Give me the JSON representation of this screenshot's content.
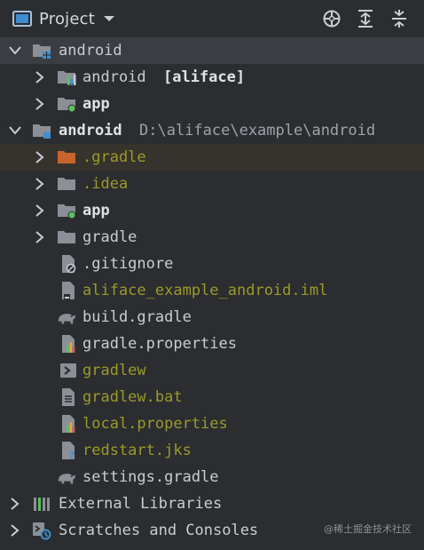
{
  "header": {
    "title": "Project",
    "icons": [
      "project-window-icon",
      "dropdown-caret-icon",
      "locate-icon",
      "expand-all-icon",
      "collapse-all-icon"
    ]
  },
  "tree": {
    "items": [
      {
        "label": "android",
        "path": "",
        "module": ""
      },
      {
        "label": "android",
        "path": "",
        "module": "[aliface]"
      },
      {
        "label": "app",
        "path": "",
        "module": ""
      },
      {
        "label": "android",
        "path": "D:\\aliface\\example\\android",
        "module": ""
      },
      {
        "label": ".gradle",
        "path": "",
        "module": ""
      },
      {
        "label": ".idea",
        "path": "",
        "module": ""
      },
      {
        "label": "app",
        "path": "",
        "module": ""
      },
      {
        "label": "gradle",
        "path": "",
        "module": ""
      },
      {
        "label": ".gitignore",
        "path": "",
        "module": ""
      },
      {
        "label": "aliface_example_android.iml",
        "path": "",
        "module": ""
      },
      {
        "label": "build.gradle",
        "path": "",
        "module": ""
      },
      {
        "label": "gradle.properties",
        "path": "",
        "module": ""
      },
      {
        "label": "gradlew",
        "path": "",
        "module": ""
      },
      {
        "label": "gradlew.bat",
        "path": "",
        "module": ""
      },
      {
        "label": "local.properties",
        "path": "",
        "module": ""
      },
      {
        "label": "redstart.jks",
        "path": "",
        "module": ""
      },
      {
        "label": "settings.gradle",
        "path": "",
        "module": ""
      },
      {
        "label": "External Libraries",
        "path": "",
        "module": ""
      },
      {
        "label": "Scratches and Consoles",
        "path": "",
        "module": ""
      }
    ]
  },
  "watermark": "@稀土掘金技术社区",
  "colors": {
    "background": "#2b2d30",
    "selected_row": "#3a3d41",
    "hover_row": "#36332d",
    "ignored_file_text": "#9b9a2b",
    "excluded_folder": "#c8642b",
    "folder": "#8b9097",
    "module_dot": "#59c25a",
    "accent_blue": "#3e8ed0"
  }
}
